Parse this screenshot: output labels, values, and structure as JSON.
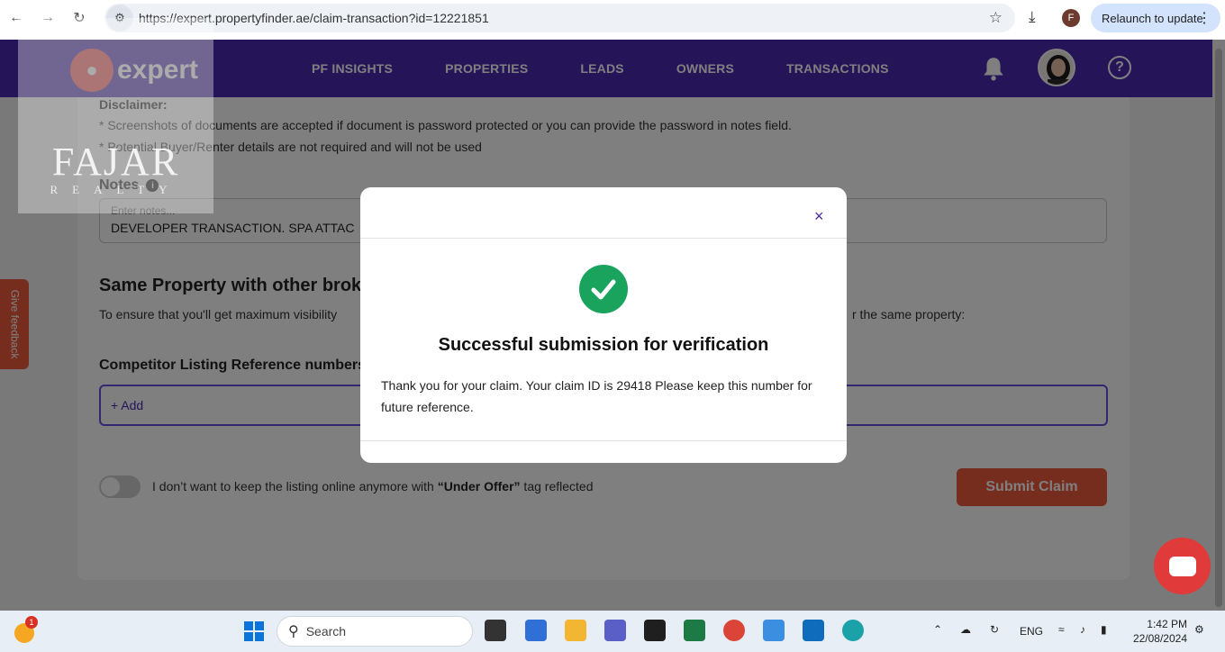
{
  "browser": {
    "url": "https://expert.propertyfinder.ae/claim-transaction?id=12221851",
    "profile_initial": "F",
    "relaunch_label": "Relaunch to update"
  },
  "app": {
    "logo_text": "expert",
    "nav": [
      "PF INSIGHTS",
      "PROPERTIES",
      "LEADS",
      "OWNERS",
      "TRANSACTIONS"
    ],
    "help_symbol": "?"
  },
  "watermark": {
    "title": "FAJAR",
    "subtitle": "REALTY"
  },
  "form": {
    "disclaimer_title": "Disclaimer:",
    "disclaimer_lines": [
      "* Screenshots of documents are accepted if document is password protected or you can provide the password in notes field.",
      "* Potential Buyer/Renter details are not required and will not be used"
    ],
    "notes_label": "Notes",
    "notes_placeholder": "Enter notes...",
    "notes_value": "DEVELOPER TRANSACTION. SPA ATTAC",
    "section_title": "Same Property with other brok",
    "section_desc": "To ensure that you'll get maximum visibility",
    "section_desc_tail": "r the same property:",
    "competitor_label": "Competitor Listing Reference numbers",
    "add_label": "+ Add",
    "toggle_text_pre": "I don’t want to keep the listing online anymore with ",
    "toggle_text_bold": "“Under Offer”",
    "toggle_text_post": " tag reflected",
    "submit_label": "Submit Claim",
    "feedback_label": "Give feedback"
  },
  "modal": {
    "title": "Successful submission for verification",
    "message": "Thank you for your claim. Your claim ID is 29418 Please keep this number for future reference.",
    "close_symbol": "×"
  },
  "taskbar": {
    "weather_badge": "1",
    "search_label": "Search",
    "language": "ENG",
    "time": "1:42 PM",
    "date": "22/08/2024"
  },
  "colors": {
    "brand": "#4a2bb0",
    "accent": "#ef5a3c",
    "success": "#19a35d"
  }
}
